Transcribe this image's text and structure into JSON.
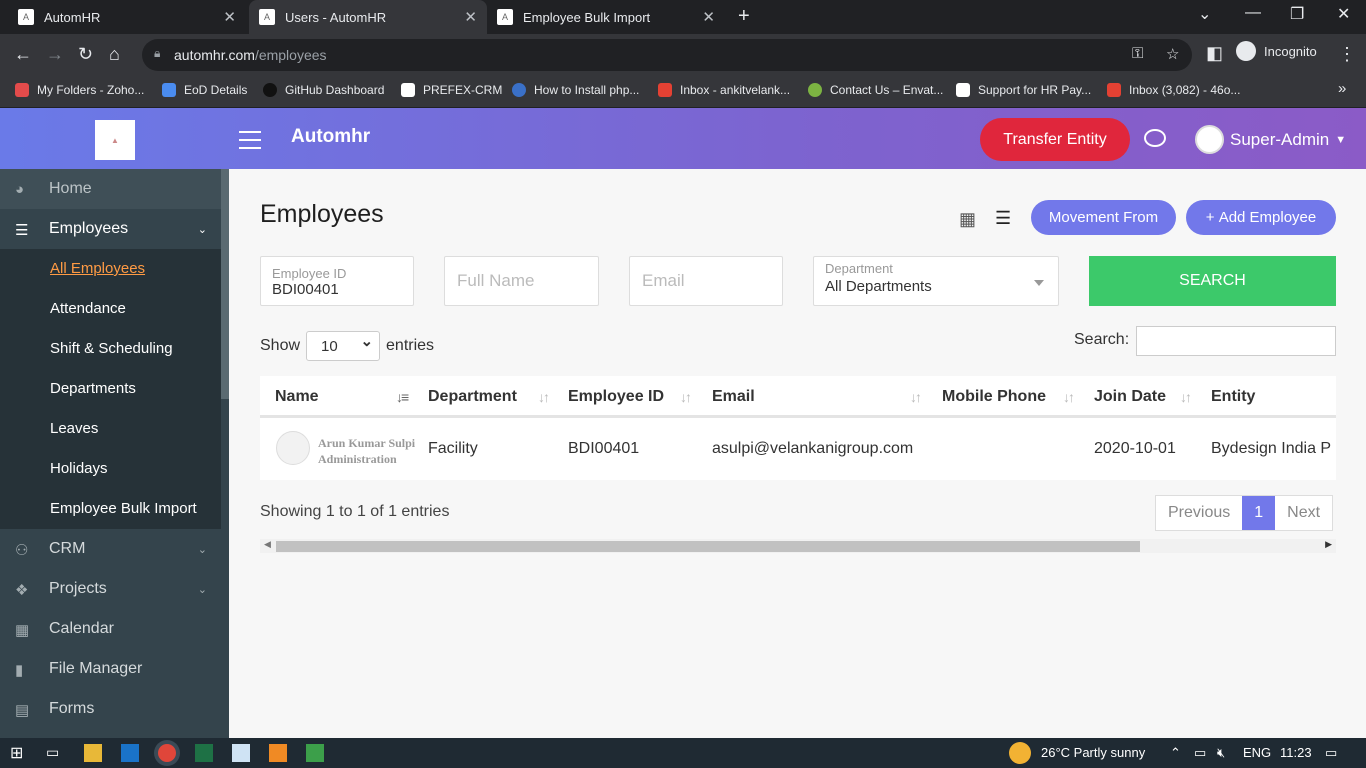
{
  "browser": {
    "tabs": [
      {
        "label": "AutomHR"
      },
      {
        "label": "Users - AutomHR"
      },
      {
        "label": "Employee Bulk Import"
      }
    ],
    "url_domain": "automhr.com",
    "url_path": "/employees",
    "incognito_label": "Incognito",
    "bookmarks": [
      {
        "label": "My Folders - Zoho...",
        "color": "#e34b4b"
      },
      {
        "label": "EoD Details",
        "color": "#4a8cf0"
      },
      {
        "label": "GitHub Dashboard",
        "color": "#222222"
      },
      {
        "label": "PREFEX-CRM",
        "color": "#ffffff"
      },
      {
        "label": "How to Install php...",
        "color": "#3a70c8"
      },
      {
        "label": "Inbox - ankitvelank...",
        "color": "#e44133"
      },
      {
        "label": "Contact Us – Envat...",
        "color": "#7cb342"
      },
      {
        "label": "Support for HR Pay...",
        "color": "#ffffff"
      },
      {
        "label": "Inbox (3,082) - 46o...",
        "color": "#e44133"
      }
    ]
  },
  "header": {
    "brand": "Automhr",
    "transfer_label": "Transfer Entity",
    "user_name": "Super-Admin",
    "accent": "#7278ea",
    "danger": "#e0263c"
  },
  "sidebar": {
    "items": [
      {
        "label": "Home",
        "icon": "dashboard-icon"
      },
      {
        "label": "Employees",
        "icon": "users-icon"
      },
      {
        "label": "CRM",
        "icon": "users-group-icon"
      },
      {
        "label": "Projects",
        "icon": "cubes-icon"
      },
      {
        "label": "Calendar",
        "icon": "calendar-icon"
      },
      {
        "label": "File Manager",
        "icon": "file-icon"
      },
      {
        "label": "Forms",
        "icon": "table-icon"
      }
    ],
    "sub_items": [
      {
        "label": "All Employees"
      },
      {
        "label": "Attendance"
      },
      {
        "label": "Shift & Scheduling"
      },
      {
        "label": "Departments"
      },
      {
        "label": "Leaves"
      },
      {
        "label": "Holidays"
      },
      {
        "label": "Employee Bulk Import"
      }
    ]
  },
  "main": {
    "title": "Employees",
    "movement_label": "Movement From",
    "add_label": "Add Employee",
    "filters": {
      "employee_id_label": "Employee ID",
      "employee_id_value": "BDI00401",
      "full_name_placeholder": "Full Name",
      "email_placeholder": "Email",
      "department_label": "Department",
      "department_value": "All Departments",
      "search_label": "SEARCH"
    },
    "show_label": "Show",
    "entries_value": "10",
    "entries_label": "entries",
    "search_label": "Search:",
    "columns": [
      "Name",
      "Department",
      "Employee ID",
      "Email",
      "Mobile Phone",
      "Join Date",
      "Entity"
    ],
    "rows": [
      {
        "name": "Arun Kumar Sulpi",
        "designation": "Administration",
        "department": "Facility",
        "employee_id": "BDI00401",
        "email": "asulpi@velankanigroup.com",
        "mobile": "",
        "join_date": "2020-10-01",
        "entity": "Bydesign India P"
      }
    ],
    "showing_text": "Showing 1 to 1 of 1 entries",
    "pager": {
      "previous": "Previous",
      "current": "1",
      "next": "Next"
    }
  },
  "taskbar": {
    "weather": "26°C  Partly sunny",
    "lang": "ENG",
    "time": "11:23"
  }
}
